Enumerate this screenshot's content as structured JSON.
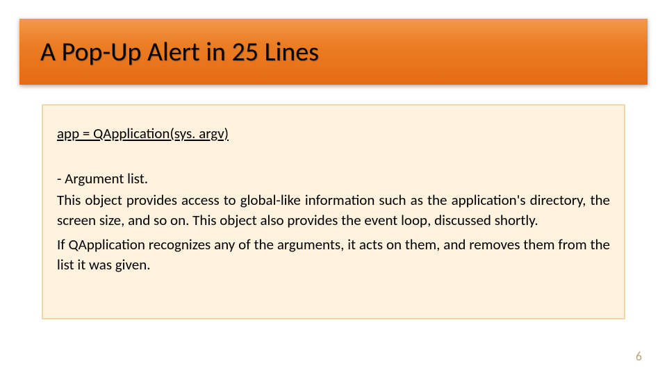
{
  "title": "A Pop-Up Alert in 25 Lines",
  "content": {
    "code_line": "app = QApplication(sys. argv)",
    "bullet": "- Argument list.",
    "para1": "This object provides access to global-like information such as the application's directory, the screen size, and so on. This object also provides the event loop, discussed shortly.",
    "para2": "If QApplication recognizes any of the arguments, it acts on them, and removes them from the list it was given."
  },
  "page_number": "6"
}
